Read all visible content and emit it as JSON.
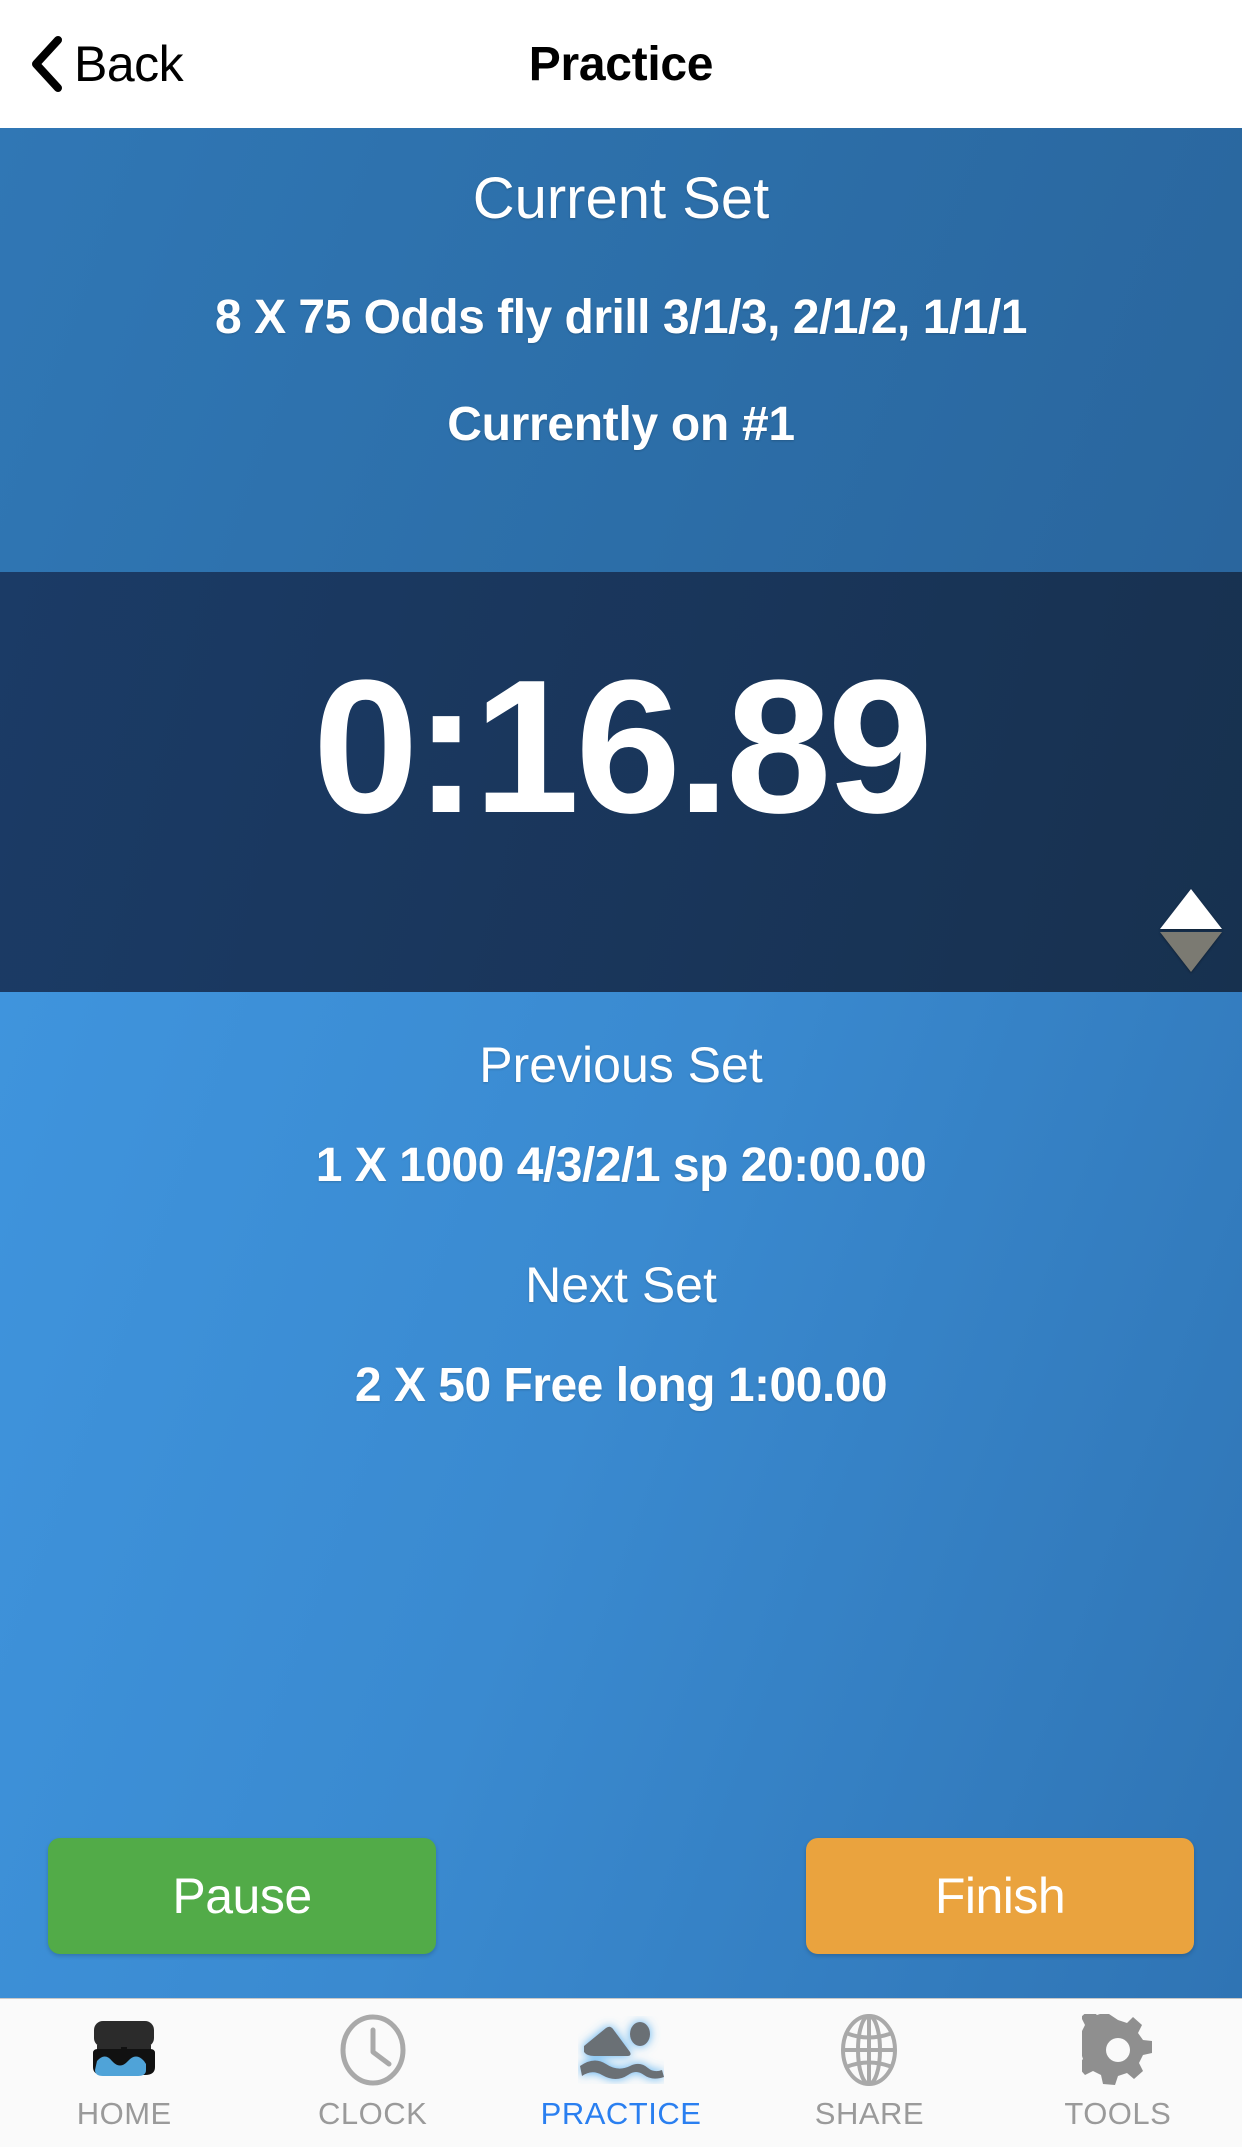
{
  "navbar": {
    "back_label": "Back",
    "back_icon": "chevron-left-icon",
    "title": "Practice"
  },
  "current_set": {
    "title": "Current Set",
    "description": "8 X 75   Odds fly drill 3/1/3, 2/1/2, 1/1/1",
    "progress": "Currently on #1"
  },
  "timer": {
    "value": "0:16.89",
    "stepper_up_icon": "triangle-up-icon",
    "stepper_down_icon": "triangle-down-icon"
  },
  "previous_set": {
    "title": "Previous Set",
    "description": "1 X 1000   4/3/2/1 sp   20:00.00"
  },
  "next_set": {
    "title": "Next Set",
    "description": "2 X 50   Free long   1:00.00"
  },
  "actions": {
    "pause_label": "Pause",
    "finish_label": "Finish"
  },
  "tabbar": {
    "items": [
      {
        "label": "HOME",
        "icon": "goggles-icon",
        "active": false
      },
      {
        "label": "CLOCK",
        "icon": "clock-icon",
        "active": false
      },
      {
        "label": "PRACTICE",
        "icon": "swimmer-icon",
        "active": true
      },
      {
        "label": "SHARE",
        "icon": "globe-icon",
        "active": false
      },
      {
        "label": "TOOLS",
        "icon": "gear-icon",
        "active": false
      }
    ]
  },
  "colors": {
    "header_bg": "#ffffff",
    "current_panel_bg": "#2c6ea8",
    "timer_panel_bg": "#193559",
    "lower_panel_bg": "#3a8ad0",
    "pause_button": "#52ab48",
    "finish_button": "#eaa33e",
    "tab_active": "#2a7ff0",
    "tab_inactive": "#9a9a9a",
    "tabbar_bg": "#fafafa"
  }
}
